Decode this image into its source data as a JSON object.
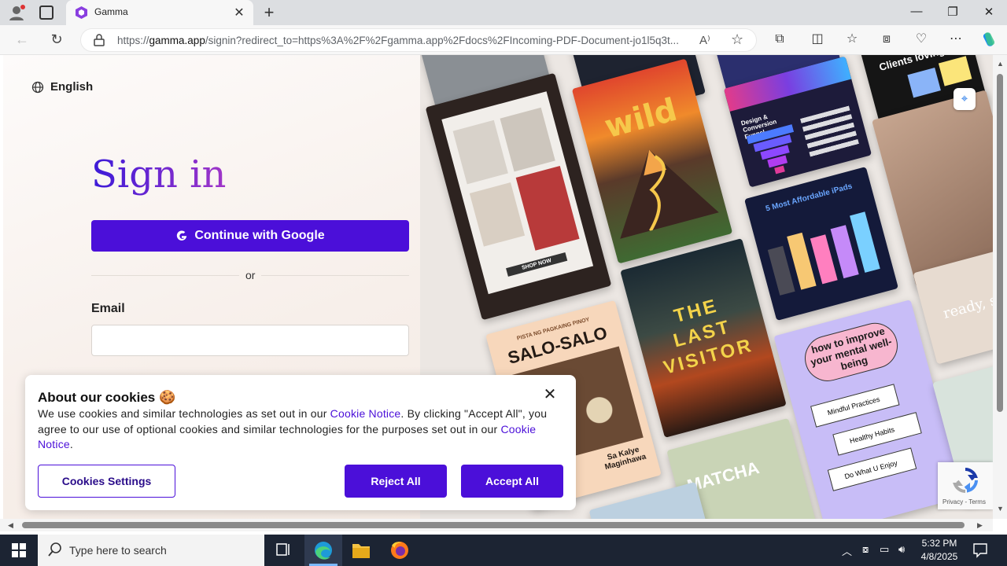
{
  "browser": {
    "tab_title": "Gamma",
    "url_domain": "gamma.app",
    "url_prefix": "https://",
    "url_rest": "/signin?redirect_to=https%3A%2F%2Fgamma.app%2Fdocs%2FIncoming-PDF-Document-jo1l5q3t..."
  },
  "page": {
    "language": "English",
    "heading": "Sign in",
    "google_button": "Continue with Google",
    "or": "or",
    "email_label": "Email",
    "email_value": ""
  },
  "collage": {
    "wild": "wild",
    "funnel": "Design & Conversion Funnel",
    "ipads": "5 Most Affordable iPads",
    "last_visitor": "THE LAST VISITOR",
    "salo_small": "PISTA NG PAGKAING PINOY",
    "salo": "SALO-SALO",
    "salo_sub": "Sa Kalye Maginhawa",
    "mental": "how to improve your mental well-being",
    "mental_items": [
      "Mindful Practices",
      "Healthy Habits",
      "Do What U Enjoy"
    ],
    "matcha": "MATCHA",
    "ready": "ready, se",
    "shop": "SHOP NOW",
    "clients": "Clients loving us"
  },
  "cookie": {
    "title": "About our cookies",
    "emoji": "🍪",
    "body_1": "We use cookies and similar technologies as set out in our ",
    "link_1": "Cookie Notice",
    "body_2": ". By clicking \"Accept All\", you agree to our use of optional cookies and similar technologies for the purposes set out in our ",
    "link_2": "Cookie Notice",
    "body_3": ".",
    "settings": "Cookies Settings",
    "reject": "Reject All",
    "accept": "Accept All"
  },
  "recaptcha": {
    "label": "Privacy - Terms"
  },
  "taskbar": {
    "search_placeholder": "Type here to search",
    "time": "5:32 PM",
    "date": "4/8/2025"
  },
  "colors": {
    "brand": "#4b0fd9",
    "taskbar": "#1c2433"
  }
}
